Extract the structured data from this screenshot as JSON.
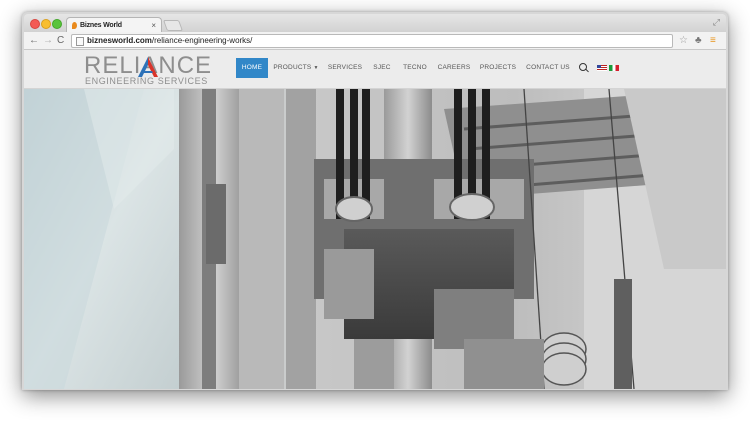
{
  "browser": {
    "tab_title": "Biznes World",
    "tab_close": "×",
    "url_host": "biznesworld.com",
    "url_path": "/reliance-engineering-works/"
  },
  "site": {
    "logo_main": "RELIANCE",
    "logo_sub": "ENGINEERING SERVICES",
    "nav": [
      {
        "label": "HOME",
        "active": true
      },
      {
        "label": "PRODUCTS",
        "dropdown": true
      },
      {
        "label": "SERVICES"
      },
      {
        "label": "SJEC"
      },
      {
        "label": "TECNO"
      },
      {
        "label": "CAREERS"
      },
      {
        "label": "PROJECTS"
      },
      {
        "label": "CONTACT US"
      }
    ],
    "languages": [
      "en",
      "it"
    ]
  },
  "colors": {
    "accent": "#3187c8",
    "logo_red": "#d9342b",
    "logo_blue": "#2d72b8"
  }
}
